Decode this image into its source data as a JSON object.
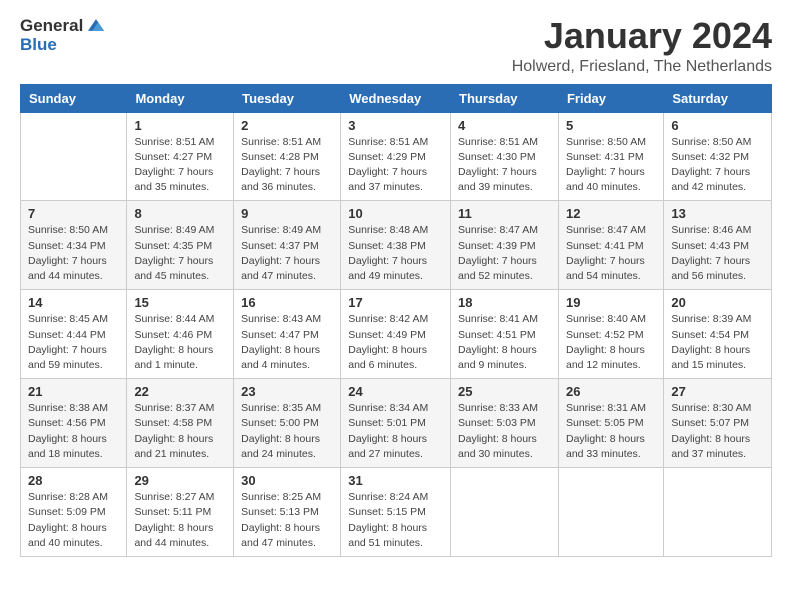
{
  "header": {
    "logo_general": "General",
    "logo_blue": "Blue",
    "month": "January 2024",
    "location": "Holwerd, Friesland, The Netherlands"
  },
  "days_of_week": [
    "Sunday",
    "Monday",
    "Tuesday",
    "Wednesday",
    "Thursday",
    "Friday",
    "Saturday"
  ],
  "weeks": [
    [
      {
        "day": "",
        "info": ""
      },
      {
        "day": "1",
        "info": "Sunrise: 8:51 AM\nSunset: 4:27 PM\nDaylight: 7 hours\nand 35 minutes."
      },
      {
        "day": "2",
        "info": "Sunrise: 8:51 AM\nSunset: 4:28 PM\nDaylight: 7 hours\nand 36 minutes."
      },
      {
        "day": "3",
        "info": "Sunrise: 8:51 AM\nSunset: 4:29 PM\nDaylight: 7 hours\nand 37 minutes."
      },
      {
        "day": "4",
        "info": "Sunrise: 8:51 AM\nSunset: 4:30 PM\nDaylight: 7 hours\nand 39 minutes."
      },
      {
        "day": "5",
        "info": "Sunrise: 8:50 AM\nSunset: 4:31 PM\nDaylight: 7 hours\nand 40 minutes."
      },
      {
        "day": "6",
        "info": "Sunrise: 8:50 AM\nSunset: 4:32 PM\nDaylight: 7 hours\nand 42 minutes."
      }
    ],
    [
      {
        "day": "7",
        "info": "Sunrise: 8:50 AM\nSunset: 4:34 PM\nDaylight: 7 hours\nand 44 minutes."
      },
      {
        "day": "8",
        "info": "Sunrise: 8:49 AM\nSunset: 4:35 PM\nDaylight: 7 hours\nand 45 minutes."
      },
      {
        "day": "9",
        "info": "Sunrise: 8:49 AM\nSunset: 4:37 PM\nDaylight: 7 hours\nand 47 minutes."
      },
      {
        "day": "10",
        "info": "Sunrise: 8:48 AM\nSunset: 4:38 PM\nDaylight: 7 hours\nand 49 minutes."
      },
      {
        "day": "11",
        "info": "Sunrise: 8:47 AM\nSunset: 4:39 PM\nDaylight: 7 hours\nand 52 minutes."
      },
      {
        "day": "12",
        "info": "Sunrise: 8:47 AM\nSunset: 4:41 PM\nDaylight: 7 hours\nand 54 minutes."
      },
      {
        "day": "13",
        "info": "Sunrise: 8:46 AM\nSunset: 4:43 PM\nDaylight: 7 hours\nand 56 minutes."
      }
    ],
    [
      {
        "day": "14",
        "info": "Sunrise: 8:45 AM\nSunset: 4:44 PM\nDaylight: 7 hours\nand 59 minutes."
      },
      {
        "day": "15",
        "info": "Sunrise: 8:44 AM\nSunset: 4:46 PM\nDaylight: 8 hours\nand 1 minute."
      },
      {
        "day": "16",
        "info": "Sunrise: 8:43 AM\nSunset: 4:47 PM\nDaylight: 8 hours\nand 4 minutes."
      },
      {
        "day": "17",
        "info": "Sunrise: 8:42 AM\nSunset: 4:49 PM\nDaylight: 8 hours\nand 6 minutes."
      },
      {
        "day": "18",
        "info": "Sunrise: 8:41 AM\nSunset: 4:51 PM\nDaylight: 8 hours\nand 9 minutes."
      },
      {
        "day": "19",
        "info": "Sunrise: 8:40 AM\nSunset: 4:52 PM\nDaylight: 8 hours\nand 12 minutes."
      },
      {
        "day": "20",
        "info": "Sunrise: 8:39 AM\nSunset: 4:54 PM\nDaylight: 8 hours\nand 15 minutes."
      }
    ],
    [
      {
        "day": "21",
        "info": "Sunrise: 8:38 AM\nSunset: 4:56 PM\nDaylight: 8 hours\nand 18 minutes."
      },
      {
        "day": "22",
        "info": "Sunrise: 8:37 AM\nSunset: 4:58 PM\nDaylight: 8 hours\nand 21 minutes."
      },
      {
        "day": "23",
        "info": "Sunrise: 8:35 AM\nSunset: 5:00 PM\nDaylight: 8 hours\nand 24 minutes."
      },
      {
        "day": "24",
        "info": "Sunrise: 8:34 AM\nSunset: 5:01 PM\nDaylight: 8 hours\nand 27 minutes."
      },
      {
        "day": "25",
        "info": "Sunrise: 8:33 AM\nSunset: 5:03 PM\nDaylight: 8 hours\nand 30 minutes."
      },
      {
        "day": "26",
        "info": "Sunrise: 8:31 AM\nSunset: 5:05 PM\nDaylight: 8 hours\nand 33 minutes."
      },
      {
        "day": "27",
        "info": "Sunrise: 8:30 AM\nSunset: 5:07 PM\nDaylight: 8 hours\nand 37 minutes."
      }
    ],
    [
      {
        "day": "28",
        "info": "Sunrise: 8:28 AM\nSunset: 5:09 PM\nDaylight: 8 hours\nand 40 minutes."
      },
      {
        "day": "29",
        "info": "Sunrise: 8:27 AM\nSunset: 5:11 PM\nDaylight: 8 hours\nand 44 minutes."
      },
      {
        "day": "30",
        "info": "Sunrise: 8:25 AM\nSunset: 5:13 PM\nDaylight: 8 hours\nand 47 minutes."
      },
      {
        "day": "31",
        "info": "Sunrise: 8:24 AM\nSunset: 5:15 PM\nDaylight: 8 hours\nand 51 minutes."
      },
      {
        "day": "",
        "info": ""
      },
      {
        "day": "",
        "info": ""
      },
      {
        "day": "",
        "info": ""
      }
    ]
  ]
}
